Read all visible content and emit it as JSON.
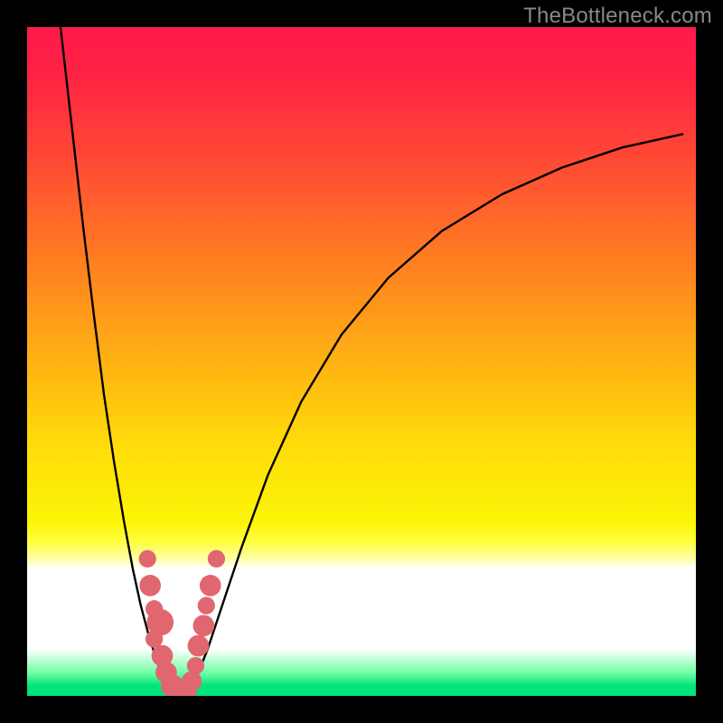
{
  "watermark": "TheBottleneck.com",
  "chart_data": {
    "type": "line",
    "title": "",
    "xlabel": "",
    "ylabel": "",
    "xlim": [
      0,
      100
    ],
    "ylim": [
      0,
      100
    ],
    "gradient_stops": [
      {
        "offset": 0.0,
        "color": "#ff1a4b"
      },
      {
        "offset": 0.07,
        "color": "#ff2244"
      },
      {
        "offset": 0.2,
        "color": "#ff4a34"
      },
      {
        "offset": 0.35,
        "color": "#ff7e21"
      },
      {
        "offset": 0.5,
        "color": "#ffb213"
      },
      {
        "offset": 0.63,
        "color": "#ffdd09"
      },
      {
        "offset": 0.74,
        "color": "#fbf507"
      },
      {
        "offset": 0.77,
        "color": "#feff40"
      },
      {
        "offset": 0.795,
        "color": "#ffffa8"
      },
      {
        "offset": 0.81,
        "color": "#ffffff"
      },
      {
        "offset": 0.93,
        "color": "#ffffff"
      },
      {
        "offset": 0.965,
        "color": "#74ffa6"
      },
      {
        "offset": 0.985,
        "color": "#00e47a"
      },
      {
        "offset": 1.0,
        "color": "#00e47a"
      }
    ],
    "series": [
      {
        "name": "left-branch",
        "x": [
          5.0,
          6.7,
          8.4,
          10.1,
          11.5,
          13.0,
          14.5,
          15.8,
          17.0,
          18.2,
          19.3,
          20.3,
          21.2
        ],
        "y": [
          100.0,
          85.0,
          70.0,
          56.0,
          45.0,
          35.0,
          26.0,
          19.0,
          13.5,
          9.0,
          5.5,
          2.8,
          1.2
        ]
      },
      {
        "name": "valley",
        "x": [
          21.2,
          22.0,
          22.8,
          23.6,
          24.4
        ],
        "y": [
          1.2,
          0.4,
          0.15,
          0.4,
          1.2
        ]
      },
      {
        "name": "right-branch",
        "x": [
          24.4,
          25.5,
          27.0,
          29.0,
          32.0,
          36.0,
          41.0,
          47.0,
          54.0,
          62.0,
          71.0,
          80.0,
          89.0,
          98.0
        ],
        "y": [
          1.2,
          3.2,
          7.0,
          13.0,
          22.0,
          33.0,
          44.0,
          54.0,
          62.5,
          69.5,
          75.0,
          79.0,
          82.0,
          84.0
        ]
      }
    ],
    "markers": {
      "name": "highlighted-points",
      "color": "#e06770",
      "points": [
        {
          "x": 18.0,
          "y": 20.5,
          "r": 1.3
        },
        {
          "x": 18.4,
          "y": 16.5,
          "r": 1.6
        },
        {
          "x": 19.0,
          "y": 13.0,
          "r": 1.3
        },
        {
          "x": 19.9,
          "y": 11.0,
          "r": 2.0
        },
        {
          "x": 19.0,
          "y": 8.5,
          "r": 1.3
        },
        {
          "x": 20.2,
          "y": 6.0,
          "r": 1.6
        },
        {
          "x": 20.8,
          "y": 3.5,
          "r": 1.6
        },
        {
          "x": 21.7,
          "y": 1.5,
          "r": 1.7
        },
        {
          "x": 22.7,
          "y": 0.7,
          "r": 1.7
        },
        {
          "x": 23.7,
          "y": 0.9,
          "r": 1.7
        },
        {
          "x": 24.6,
          "y": 2.2,
          "r": 1.5
        },
        {
          "x": 25.2,
          "y": 4.5,
          "r": 1.3
        },
        {
          "x": 25.6,
          "y": 7.5,
          "r": 1.6
        },
        {
          "x": 26.4,
          "y": 10.5,
          "r": 1.6
        },
        {
          "x": 26.8,
          "y": 13.5,
          "r": 1.3
        },
        {
          "x": 27.4,
          "y": 16.5,
          "r": 1.6
        },
        {
          "x": 28.3,
          "y": 20.5,
          "r": 1.3
        }
      ]
    }
  }
}
